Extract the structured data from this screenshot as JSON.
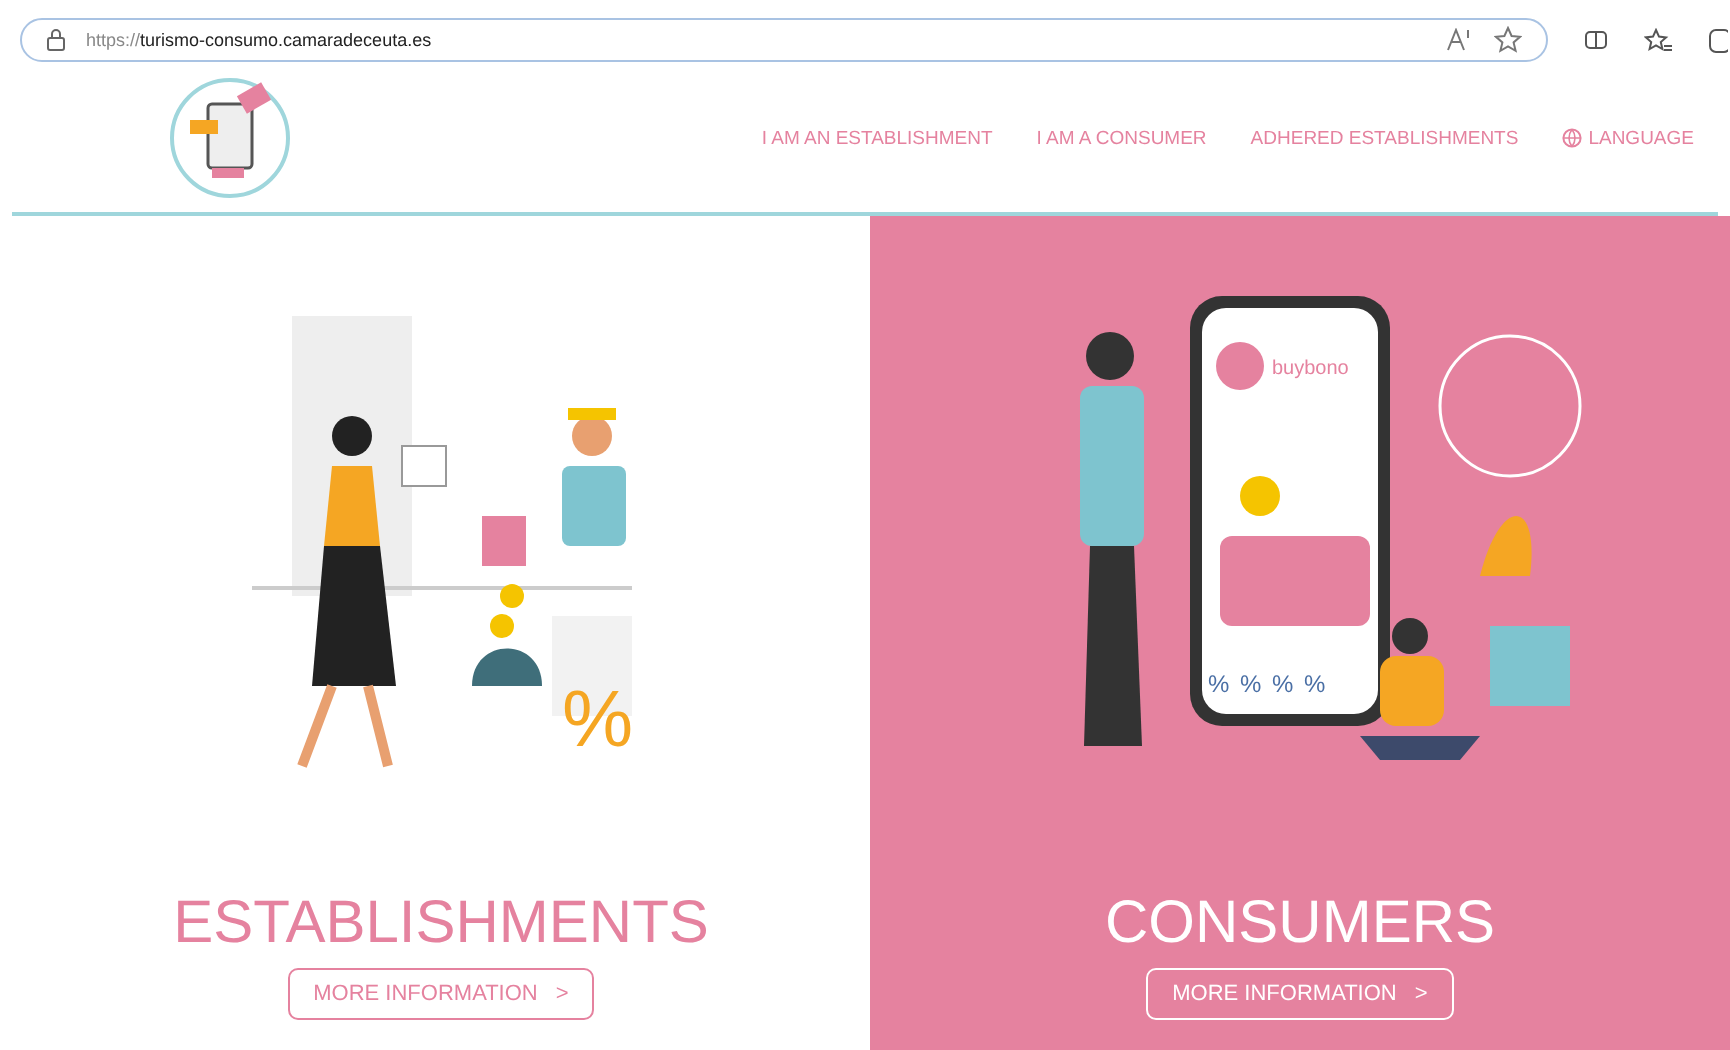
{
  "browser": {
    "url_prefix": "https://",
    "url_domain": "turismo-consumo.camaradeceuta.es"
  },
  "nav": {
    "items": [
      {
        "label": "I AM AN ESTABLISHMENT",
        "kind": "link"
      },
      {
        "label": "I AM A CONSUMER",
        "kind": "link"
      },
      {
        "label": "ADHERED ESTABLISHMENTS",
        "kind": "link"
      },
      {
        "label": "LANGUAGE",
        "kind": "language"
      }
    ]
  },
  "panels": [
    {
      "kind": "establishments",
      "title": "ESTABLISHMENTS",
      "button": "MORE INFORMATION",
      "arrow": ">",
      "percent": "%"
    },
    {
      "kind": "consumers",
      "title": "CONSUMERS",
      "button": "MORE INFORMATION",
      "arrow": ">",
      "phone_brand": "buybono",
      "discounts": [
        "%",
        "%",
        "%",
        "%"
      ]
    }
  ]
}
